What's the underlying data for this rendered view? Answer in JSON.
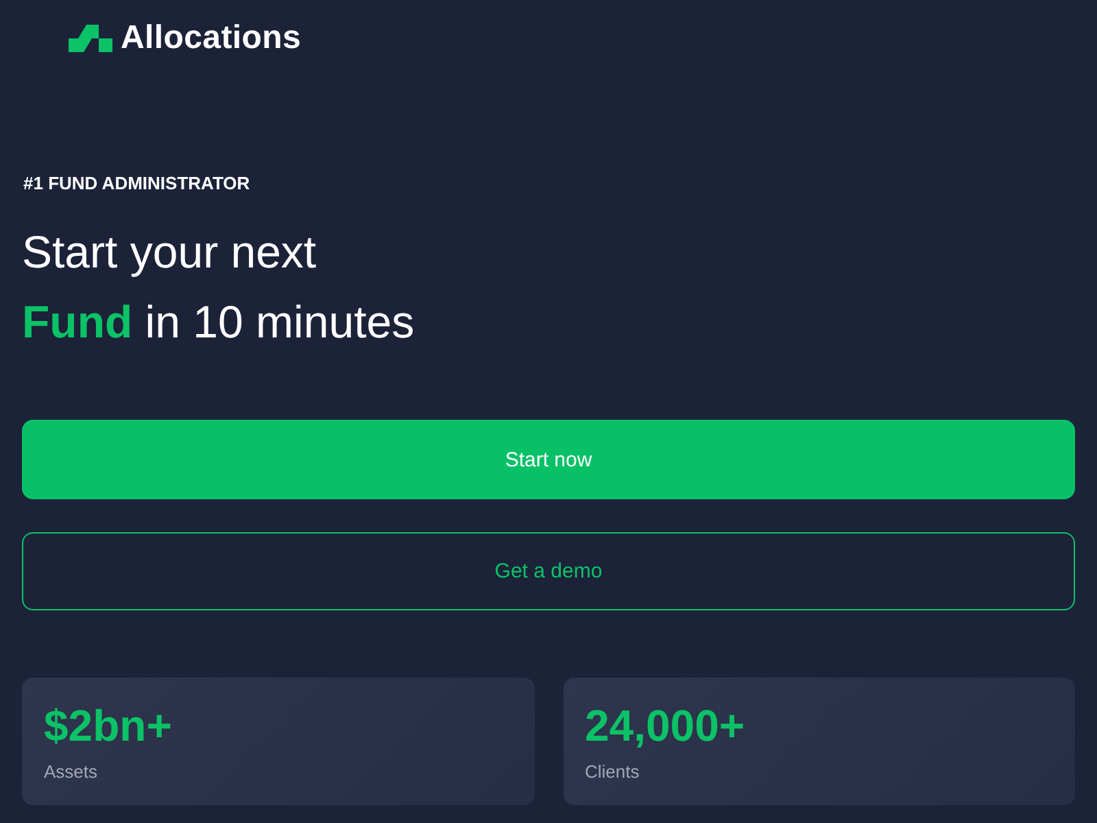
{
  "logo": {
    "text": "Allocations"
  },
  "hero": {
    "eyebrow": "#1 FUND ADMINISTRATOR",
    "headline": [
      "Start your next",
      "**Fund** in 10 minutes"
    ]
  },
  "buttons": [
    {
      "label": "Start now",
      "kind": "primary"
    },
    {
      "label": "Get a demo",
      "kind": "outline"
    }
  ],
  "stats": [
    {
      "value": "$2bn+",
      "label": "Assets"
    },
    {
      "value": "24,000+",
      "label": "Clients"
    }
  ]
}
